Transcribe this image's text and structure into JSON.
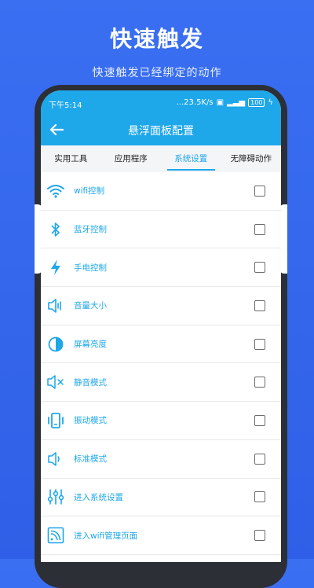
{
  "header": {
    "title": "快速触发",
    "subtitle": "快速触发已经绑定的动作"
  },
  "status_bar": {
    "time": "下午5:14",
    "network_speed": "...23.5K/s",
    "battery": "100"
  },
  "app_bar": {
    "title": "悬浮面板配置"
  },
  "tabs": [
    {
      "label": "实用工具",
      "active": false
    },
    {
      "label": "应用程序",
      "active": false
    },
    {
      "label": "系统设置",
      "active": true
    },
    {
      "label": "无障碍动作",
      "active": false
    }
  ],
  "items": [
    {
      "label": "wifi控制",
      "icon": "wifi-icon",
      "checked": false
    },
    {
      "label": "蓝牙控制",
      "icon": "bluetooth-icon",
      "checked": false
    },
    {
      "label": "手电控制",
      "icon": "flash-icon",
      "checked": false
    },
    {
      "label": "音量大小",
      "icon": "volume-icon",
      "checked": false
    },
    {
      "label": "屏幕亮度",
      "icon": "brightness-icon",
      "checked": false
    },
    {
      "label": "静音模式",
      "icon": "mute-icon",
      "checked": false
    },
    {
      "label": "振动模式",
      "icon": "vibrate-icon",
      "checked": false
    },
    {
      "label": "标准模式",
      "icon": "speaker-icon",
      "checked": false
    },
    {
      "label": "进入系统设置",
      "icon": "sliders-icon",
      "checked": false
    },
    {
      "label": "进入wifi管理页面",
      "icon": "wifi-settings-icon",
      "checked": false
    }
  ],
  "colors": {
    "accent": "#1ea7e9",
    "background": "#3a6ff2"
  }
}
